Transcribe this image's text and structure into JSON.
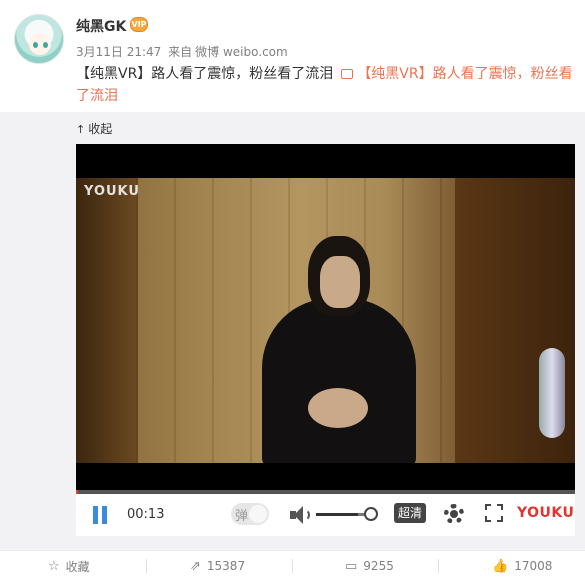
{
  "post": {
    "username": "纯黑GK",
    "vip_badge": "VIP",
    "date": "3月11日 21:47",
    "source_prefix": "来自",
    "source": "微博 weibo.com",
    "text": "【纯黑VR】路人看了震惊，粉丝看了流泪",
    "video_link": "【纯黑VR】路人看了震惊，粉丝看了流泪"
  },
  "media": {
    "collapse_label": "收起",
    "watermark": "YOUKU",
    "progress_percent": 0.4
  },
  "player": {
    "time": "00:13",
    "danmu_label": "弹",
    "volume_percent": 75,
    "quality_label": "超清",
    "logo": "YOUKU"
  },
  "actions": {
    "favorite_label": "收藏",
    "repost_count": "15387",
    "comment_count": "9255",
    "like_count": "17008"
  },
  "colors": {
    "accent_link": "#eb7350",
    "play_blue": "#3a8bdc",
    "youku_red": "#e3342f"
  }
}
